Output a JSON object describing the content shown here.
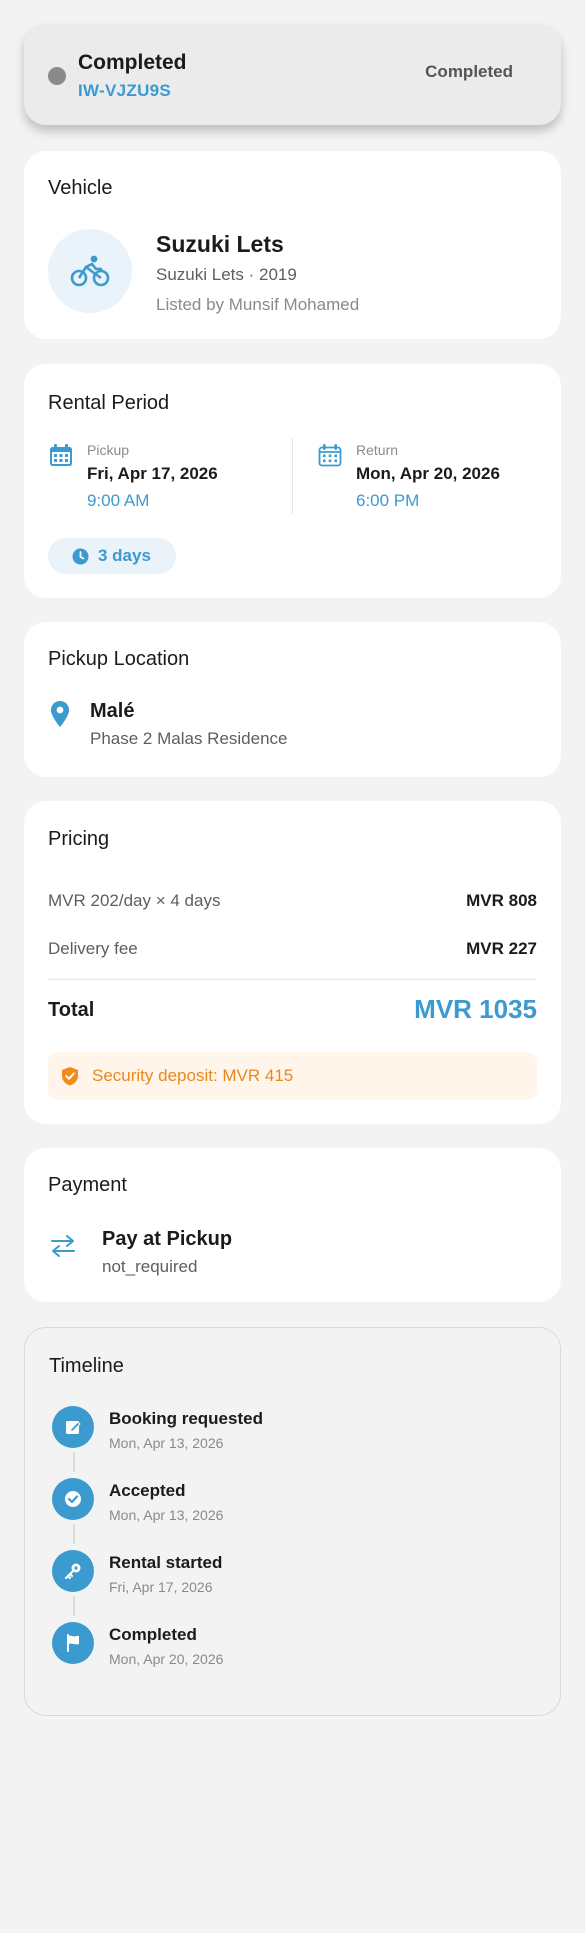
{
  "status": {
    "title": "Completed",
    "code": "IW-VJZU9S",
    "badge": "Completed",
    "dot_color": "#8a8a8a"
  },
  "vehicle": {
    "section_title": "Vehicle",
    "icon": "bicycle-icon",
    "name": "Suzuki Lets",
    "subtitle": "Suzuki Lets · 2019",
    "owner": "Listed by Munsif Mohamed"
  },
  "rental_period": {
    "section_title": "Rental Period",
    "pickup": {
      "label": "Pickup",
      "date": "Fri, Apr 17, 2026",
      "time": "9:00 AM",
      "icon": "calendar-icon"
    },
    "return": {
      "label": "Return",
      "date": "Mon, Apr 20, 2026",
      "time": "6:00 PM",
      "icon": "calendar-icon"
    },
    "duration": "3 days"
  },
  "pickup_location": {
    "section_title": "Pickup Location",
    "icon": "map-pin-icon",
    "name": "Malé",
    "address": "Phase 2 Malas Residence"
  },
  "pricing": {
    "section_title": "Pricing",
    "lines": [
      {
        "label": "MVR 202/day × 4 days",
        "value": "MVR 808"
      },
      {
        "label": "Delivery fee",
        "value": "MVR 227"
      }
    ],
    "total_label": "Total",
    "total_value": "MVR 1035",
    "deposit": "Security deposit: MVR 415"
  },
  "payment": {
    "section_title": "Payment",
    "icon": "exchange-arrows-icon",
    "method": "Pay at Pickup",
    "status": "not_required"
  },
  "timeline": {
    "section_title": "Timeline",
    "events": [
      {
        "title": "Booking requested",
        "date": "Mon, Apr 13, 2026",
        "icon": "edit-icon"
      },
      {
        "title": "Accepted",
        "date": "Mon, Apr 13, 2026",
        "icon": "check-circle-icon"
      },
      {
        "title": "Rental started",
        "date": "Fri, Apr 17, 2026",
        "icon": "key-icon"
      },
      {
        "title": "Completed",
        "date": "Mon, Apr 20, 2026",
        "icon": "flag-icon"
      }
    ]
  },
  "colors": {
    "accent": "#3b9ad0",
    "warning": "#e8891e",
    "background": "#f3f3f3"
  }
}
